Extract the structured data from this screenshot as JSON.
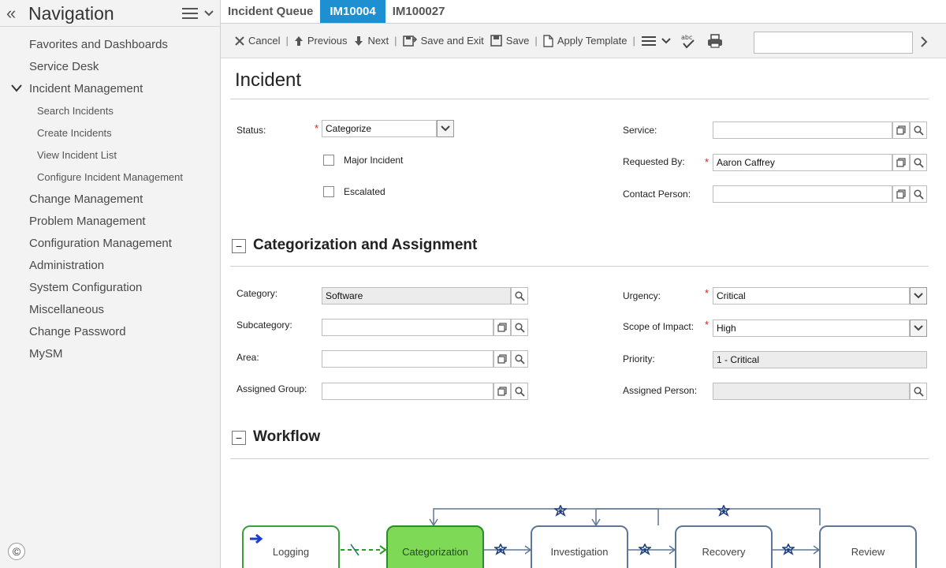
{
  "nav": {
    "title": "Navigation",
    "items": [
      {
        "label": "Favorites and Dashboards"
      },
      {
        "label": "Service Desk"
      },
      {
        "label": "Incident Management",
        "expanded": true
      },
      {
        "label": "Change Management"
      },
      {
        "label": "Problem Management"
      },
      {
        "label": "Configuration Management"
      },
      {
        "label": "Administration"
      },
      {
        "label": "System Configuration"
      },
      {
        "label": "Miscellaneous"
      },
      {
        "label": "Change Password"
      },
      {
        "label": "MySM"
      }
    ],
    "sub_items": [
      {
        "label": "Search Incidents"
      },
      {
        "label": "Create Incidents"
      },
      {
        "label": "View Incident List"
      },
      {
        "label": "Configure Incident Management"
      }
    ]
  },
  "tabs": [
    {
      "label": "Incident Queue"
    },
    {
      "label": "IM10004",
      "active": true
    },
    {
      "label": "IM100027"
    }
  ],
  "toolbar": {
    "cancel": "Cancel",
    "previous": "Previous",
    "next": "Next",
    "save_exit": "Save and Exit",
    "save": "Save",
    "apply_template": "Apply Template"
  },
  "form": {
    "title": "Incident",
    "status_label": "Status:",
    "status_value": "Categorize",
    "major_incident_label": "Major Incident",
    "escalated_label": "Escalated",
    "service_label": "Service:",
    "service_value": "",
    "requested_by_label": "Requested By:",
    "requested_by_value": "Aaron Caffrey",
    "contact_label": "Contact Person:",
    "contact_value": ""
  },
  "categorization": {
    "title": "Categorization and Assignment",
    "category_label": "Category:",
    "category_value": "Software",
    "subcategory_label": "Subcategory:",
    "subcategory_value": "",
    "area_label": "Area:",
    "area_value": "",
    "assigned_group_label": "Assigned Group:",
    "assigned_group_value": "",
    "urgency_label": "Urgency:",
    "urgency_value": "Critical",
    "scope_label": "Scope of Impact:",
    "scope_value": "High",
    "priority_label": "Priority:",
    "priority_value": "1 - Critical",
    "assigned_person_label": "Assigned Person:",
    "assigned_person_value": ""
  },
  "workflow": {
    "title": "Workflow",
    "phases": [
      {
        "label": "Logging",
        "state": "done"
      },
      {
        "label": "Categorization",
        "state": "current"
      },
      {
        "label": "Investigation",
        "state": "pending"
      },
      {
        "label": "Recovery",
        "state": "pending"
      },
      {
        "label": "Review",
        "state": "pending"
      }
    ]
  },
  "colors": {
    "accent": "#1e8fd1",
    "required": "#d62020",
    "current_phase": "#7ed957",
    "phase_border": "#5e7796"
  },
  "footer": {
    "copyright_symbol": "©"
  }
}
